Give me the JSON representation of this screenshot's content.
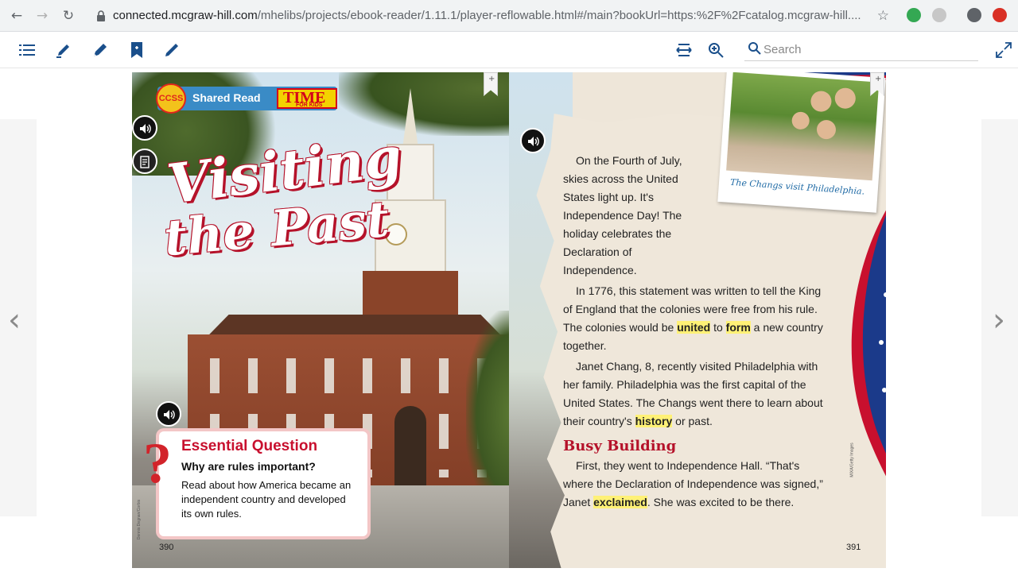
{
  "browser": {
    "url_host": "connected.mcgraw-hill.com",
    "url_path": "/mhelibs/projects/ebook-reader/1.11.1/player-reflowable.html#/main?bookUrl=https:%2F%2Fcatalog.mcgraw-hill...."
  },
  "toolbar": {
    "search_placeholder": "Search"
  },
  "left_page": {
    "badge_ccss": "CCSS",
    "badge_shared_read": "Shared Read",
    "badge_time": "TIME",
    "badge_for_kids": "FOR KIDS",
    "title_line1": "Visiting",
    "title_line2": "the Past",
    "essential_question_title": "Essential Question",
    "essential_question": "Why are rules important?",
    "essential_body": "Read about how America became an independent country and developed its own rules.",
    "page_number": "390",
    "photo_credit": "Dennis Degnan/Corbis"
  },
  "right_page": {
    "photo_caption": "The Changs visit Philadelphia.",
    "p1": "On the Fourth of July, skies across the United States light up. It's Independence Day! The holiday celebrates the Declaration of Independence.",
    "p2_a": "In 1776, this statement was written to tell the King of England that the colonies were free from his rule. The colonies would be ",
    "p2_h1": "united",
    "p2_b": " to ",
    "p2_h2": "form",
    "p2_c": " a new country together.",
    "p3_a": "Janet Chang, 8, recently visited Philadelphia with her family. Philadelphia was the first capital of the United States. The Changs went there to learn about their country's ",
    "p3_h": "history",
    "p3_b": " or past.",
    "subhead": "Busy Building",
    "p4_a": "First, they went to Independence Hall. “That's where the Declaration of Independence was signed,” Janet ",
    "p4_h": "exclaimed",
    "p4_b": ". She was excited to be there.",
    "page_number": "391",
    "photo_credit": "MIXA/Getty Images"
  },
  "icons": {
    "back": "back-arrow-icon",
    "forward": "forward-arrow-icon",
    "reload": "reload-icon",
    "toc": "list-icon",
    "highlighter": "highlighter-icon",
    "pen": "pen-icon",
    "bookmark": "bookmark-icon",
    "pencil": "pencil-icon",
    "fit_width": "fit-width-icon",
    "zoom": "zoom-in-icon",
    "fullscreen": "fullscreen-icon",
    "audio": "audio-icon"
  },
  "colors": {
    "title_red": "#b5122a",
    "highlight": "#fff176",
    "toolbar_icon": "#1a4f8b"
  }
}
